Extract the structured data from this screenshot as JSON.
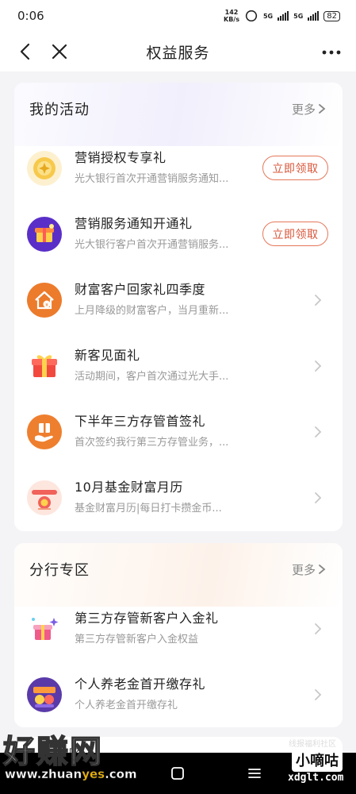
{
  "status_bar": {
    "time": "0:06",
    "net_speed_value": "142",
    "net_speed_unit": "KB/s",
    "network1": "5G",
    "network2": "5G",
    "battery": "82"
  },
  "nav": {
    "title": "权益服务"
  },
  "my_activities": {
    "title": "我的活动",
    "more_label": "更多",
    "items": [
      {
        "title": "营销授权专享礼",
        "desc": "光大银行首次开通营销服务通知...",
        "action": "立即领取",
        "icon": "gold-coin-icon"
      },
      {
        "title": "营销服务通知开通礼",
        "desc": "光大银行客户首次开通营销服务...",
        "action": "立即领取",
        "icon": "gift-box-icon"
      },
      {
        "title": "财富客户回家礼四季度",
        "desc": "上月降级的财富客户，当月重新...",
        "icon": "house-coin-icon"
      },
      {
        "title": "新客见面礼",
        "desc": "活动期间，客户首次通过光大手...",
        "icon": "red-gift-icon"
      },
      {
        "title": "下半年三方存管首签礼",
        "desc": "首次签约我行第三方存管业务，...",
        "icon": "hand-gift-icon"
      },
      {
        "title": "10月基金财富月历",
        "desc": "基金财富月历|每日打卡攒金币...",
        "icon": "fund-calendar-icon"
      }
    ]
  },
  "branch_zone": {
    "title": "分行专区",
    "more_label": "更多",
    "items": [
      {
        "title": "第三方存管新客户入金礼",
        "desc": "第三方存管新客户入金权益",
        "icon": "sparkle-gift-icon"
      },
      {
        "title": "个人养老金首开缴存礼",
        "desc": "个人养老金首开缴存礼",
        "icon": "pension-badge-icon"
      }
    ]
  },
  "peek_section": {
    "title": "ᴀ 三  ᴚ  区"
  },
  "watermarks": {
    "left_brand": "好赚网",
    "left_url_prefix": "www.zhuan",
    "left_url_highlight": "yes",
    "left_url_suffix": ".com",
    "right_small": "线报福利社区",
    "right_brand": "小嘀咕",
    "right_url": "xdglt.com"
  },
  "colors": {
    "accent": "#d9563a",
    "accent_border": "#e5775a",
    "background": "#f4f4f6",
    "card": "#ffffff",
    "secondary_text": "#999999"
  }
}
